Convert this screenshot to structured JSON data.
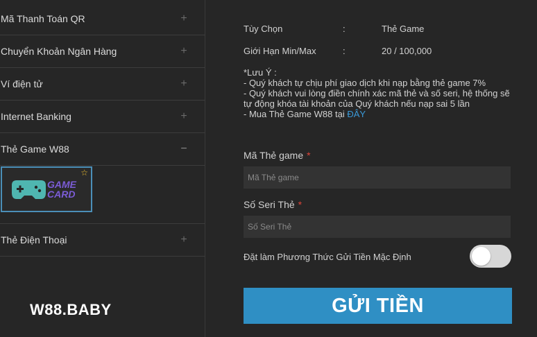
{
  "sidebar": {
    "items": [
      {
        "label": "Mã Thanh Toán QR",
        "toggle": "+"
      },
      {
        "label": "Chuyển Khoản Ngân Hàng",
        "toggle": "+"
      },
      {
        "label": "Ví điện tử",
        "toggle": "+"
      },
      {
        "label": "Internet Banking",
        "toggle": "+"
      },
      {
        "label": "Thẻ Game W88",
        "toggle": "−"
      },
      {
        "label": "Thẻ Điện Thoại",
        "toggle": "+"
      }
    ],
    "game_card": {
      "line1": "GAME",
      "line2": "CARD",
      "icon": "gamepad-icon",
      "badge_icon": "star-icon"
    }
  },
  "brand": "W88.BABY",
  "form": {
    "option_label": "Tùy Chọn",
    "option_sep": ":",
    "option_value": "Thẻ Game",
    "limit_label": "Giới Hạn Min/Max",
    "limit_sep": ":",
    "limit_value": "20 / 100,000",
    "notes": {
      "title": "*Lưu Ý :",
      "line1": "- Quý khách tự chịu phí giao dịch khi nạp bằng thẻ game 7%",
      "line2": "- Quý khách vui lòng điền chính xác mã thẻ và số seri, hệ thống sẽ tự động khóa tài khoản của Quý khách nếu nạp sai 5 lần",
      "line3_prefix": "- Mua Thẻ Game W88 tại ",
      "line3_link": "ĐÂY"
    },
    "card_code_label": "Mã Thẻ game",
    "card_code_placeholder": "Mã Thẻ game",
    "serial_label": "Số Seri Thẻ",
    "serial_placeholder": "Số Seri Thẻ",
    "required_mark": "*",
    "default_method_label": "Đặt làm Phương Thức Gửi Tiền Mặc Định",
    "default_method_on": false,
    "submit_label": "GỬI TIỀN"
  },
  "colors": {
    "background": "#262626",
    "accent": "#2f8fc4",
    "link": "#3a9ad9",
    "required": "#e0453a",
    "card_border": "#4b8fb8",
    "card_text": "#7b5cd6",
    "gamepad": "#4fb6b0"
  }
}
